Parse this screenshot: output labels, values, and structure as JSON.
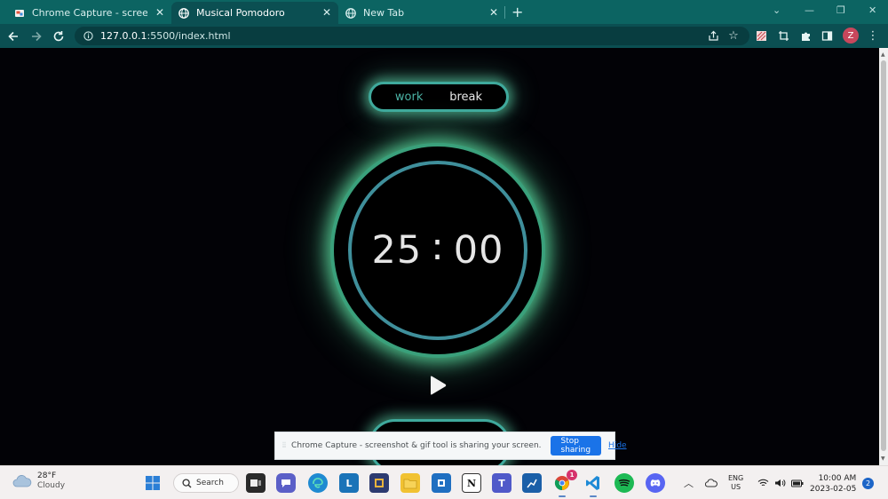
{
  "browser": {
    "tabs": [
      {
        "title": "Chrome Capture - screenshot & gif tool",
        "favicon": "chrome-capture-icon",
        "active": false
      },
      {
        "title": "Musical Pomodoro",
        "favicon": "globe-icon",
        "active": true
      },
      {
        "title": "New Tab",
        "favicon": "globe-icon",
        "active": false
      }
    ],
    "url_host": "127.0.0.1",
    "url_rest": ":5500/index.html",
    "profile_initial": "Z"
  },
  "app": {
    "modes": {
      "work": "work",
      "break": "break",
      "active": "work"
    },
    "timer": {
      "minutes": "25",
      "seconds": "00",
      "separator": ":"
    },
    "play_icon": "play-icon",
    "colors": {
      "accent": "#3fa99c",
      "glow": "#60e8aa",
      "ring": "#3f8f9b",
      "background": "#020206"
    }
  },
  "share_bar": {
    "message": "Chrome Capture - screenshot & gif tool is sharing your screen.",
    "stop_label": "Stop sharing",
    "hide_label": "Hide"
  },
  "taskbar": {
    "weather_temp": "28°F",
    "weather_cond": "Cloudy",
    "search_label": "Search",
    "lang_line1": "ENG",
    "lang_line2": "US",
    "time": "10:00 AM",
    "date": "2023-02-05",
    "notification_count": "2",
    "chrome_badge": "1"
  }
}
